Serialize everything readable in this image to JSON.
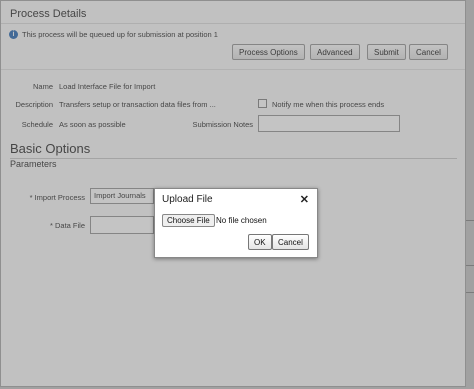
{
  "dialog": {
    "title": "Process Details",
    "info_message": "This process will be queued up for submission at position 1",
    "buttons": {
      "process_options": "Process Options",
      "advanced": "Advanced",
      "submit": "Submit",
      "cancel": "Cancel"
    },
    "fields": {
      "name_label": "Name",
      "name_value": "Load Interface File for Import",
      "description_label": "Description",
      "description_value": "Transfers setup or transaction data files from ...",
      "schedule_label": "Schedule",
      "schedule_value": "As soon as possible",
      "notify_label": "Notify me when this process ends",
      "submission_notes_label": "Submission Notes",
      "submission_notes_value": ""
    },
    "basic_options": {
      "heading": "Basic Options",
      "parameters_heading": "Parameters",
      "import_process_label": "* Import Process",
      "import_process_value": "Import Journals",
      "data_file_label": "* Data File",
      "data_file_value": ""
    }
  },
  "upload_modal": {
    "title": "Upload File",
    "close_glyph": "✕",
    "choose_file_label": "Choose File",
    "file_status": "No file chosen",
    "ok_label": "OK",
    "cancel_label": "Cancel"
  },
  "colors": {
    "info_icon": "#2f6fb6",
    "overlay": "rgba(100,100,100,0.38)"
  }
}
